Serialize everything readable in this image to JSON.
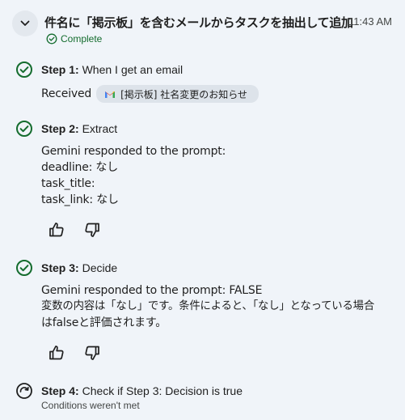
{
  "header": {
    "title": "件名に「掲示板」を含むメールからタスクを抽出して追加",
    "time": "11:43 AM",
    "status": "Complete"
  },
  "steps": [
    {
      "label": "Step 1:",
      "text": "When I get an email",
      "received_label": "Received",
      "chip_text": "[掲示板] 社名変更のお知らせ"
    },
    {
      "label": "Step 2:",
      "text": "Extract",
      "lines": [
        "Gemini responded to the prompt:",
        "deadline: なし",
        "task_title:",
        "task_link: なし"
      ]
    },
    {
      "label": "Step 3:",
      "text": "Decide",
      "lines": [
        "Gemini responded to the prompt: FALSE",
        "変数の内容は「なし」です。条件によると、「なし」となっている場合",
        "はfalseと評価されます。"
      ]
    },
    {
      "label": "Step 4:",
      "text": "Check if Step 3: Decision is true",
      "subtext": "Conditions weren't met"
    }
  ],
  "colors": {
    "success": "#146c2e",
    "background": "#f0f4f9",
    "chip": "#dde3ea"
  },
  "icons": [
    "chevron-down-icon",
    "check-circle-icon",
    "gmail-icon",
    "thumb-up-icon",
    "thumb-down-icon",
    "skipped-icon"
  ]
}
